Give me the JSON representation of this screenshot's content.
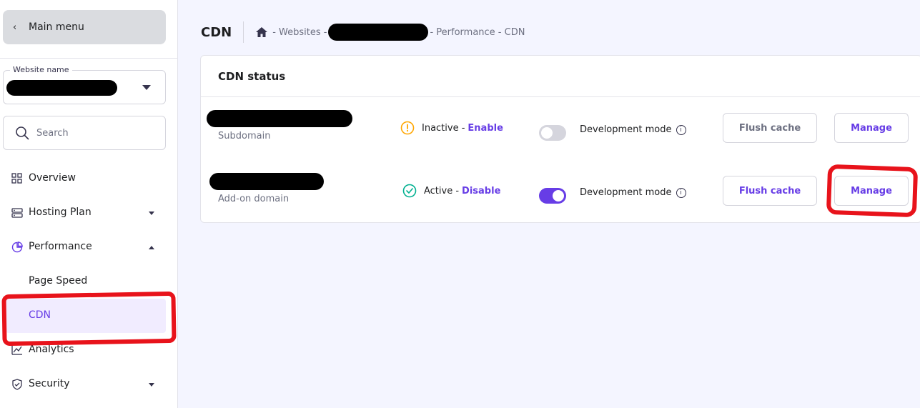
{
  "sidebar": {
    "main_menu_label": "Main menu",
    "website_select_label": "Website name",
    "search_placeholder": "Search",
    "nav": {
      "overview": "Overview",
      "hosting_plan": "Hosting Plan",
      "performance": "Performance",
      "page_speed": "Page Speed",
      "cdn": "CDN",
      "analytics": "Analytics",
      "security": "Security"
    }
  },
  "header": {
    "title": "CDN",
    "breadcrumb": {
      "sep1": "- Websites -",
      "sep2": "- Performance - CDN"
    }
  },
  "card": {
    "title": "CDN status",
    "rows": [
      {
        "type": "Subdomain",
        "status_text": "Inactive -",
        "status_action": "Enable",
        "dev_mode_label": "Development mode",
        "flush_label": "Flush cache",
        "manage_label": "Manage"
      },
      {
        "type": "Add-on domain",
        "status_text": "Active -",
        "status_action": "Disable",
        "dev_mode_label": "Development mode",
        "flush_label": "Flush cache",
        "manage_label": "Manage"
      }
    ]
  },
  "colors": {
    "accent": "#673de6",
    "warning": "#ffa600",
    "success": "#00b090",
    "annotation": "#e8131b"
  }
}
